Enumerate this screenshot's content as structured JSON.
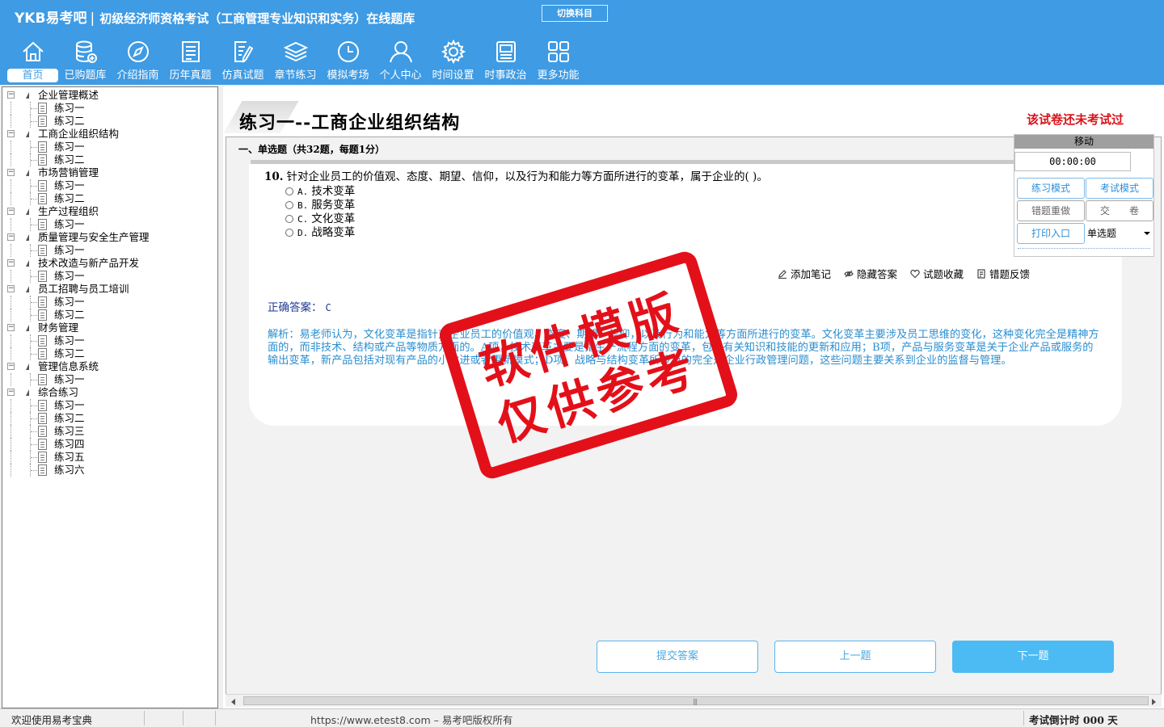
{
  "header": {
    "brand": "YKB易考吧",
    "separator": "|",
    "exam_title": "初级经济师资格考试（工商管理专业知识和实务）在线题库",
    "switch_subject": "切换科目",
    "nav": [
      {
        "label": "首页",
        "icon": "home-icon"
      },
      {
        "label": "已购题库",
        "icon": "database-icon"
      },
      {
        "label": "介绍指南",
        "icon": "compass-icon"
      },
      {
        "label": "历年真题",
        "icon": "list-icon"
      },
      {
        "label": "仿真试题",
        "icon": "edit-document-icon"
      },
      {
        "label": "章节练习",
        "icon": "layers-icon"
      },
      {
        "label": "模拟考场",
        "icon": "clock-icon"
      },
      {
        "label": "个人中心",
        "icon": "user-icon"
      },
      {
        "label": "时间设置",
        "icon": "gear-icon"
      },
      {
        "label": "时事政治",
        "icon": "newspaper-icon"
      },
      {
        "label": "更多功能",
        "icon": "grid-icon"
      }
    ]
  },
  "tree": [
    {
      "label": "企业管理概述",
      "children": [
        "练习一",
        "练习二"
      ]
    },
    {
      "label": "工商企业组织结构",
      "children": [
        "练习一",
        "练习二"
      ]
    },
    {
      "label": "市场营销管理",
      "children": [
        "练习一",
        "练习二"
      ]
    },
    {
      "label": "生产过程组织",
      "children": [
        "练习一"
      ]
    },
    {
      "label": "质量管理与安全生产管理",
      "children": [
        "练习一"
      ]
    },
    {
      "label": "技术改造与新产品开发",
      "children": [
        "练习一"
      ]
    },
    {
      "label": "员工招聘与员工培训",
      "children": [
        "练习一",
        "练习二"
      ]
    },
    {
      "label": "财务管理",
      "children": [
        "练习一",
        "练习二"
      ]
    },
    {
      "label": "管理信息系统",
      "children": [
        "练习一"
      ]
    },
    {
      "label": "综合练习",
      "children": [
        "练习一",
        "练习二",
        "练习三",
        "练习四",
        "练习五",
        "练习六"
      ]
    }
  ],
  "main": {
    "page_title": "练习一--工商企业组织结构",
    "not_taken": "该试卷还未考试过",
    "section_title": "一、单选题（共32题，每题1分）",
    "question": {
      "number": "10.",
      "text": "针对企业员工的价值观、态度、期望、信仰，以及行为和能力等方面所进行的变革，属于企业的( )。",
      "options": [
        {
          "letter": "A.",
          "text": "技术变革"
        },
        {
          "letter": "B.",
          "text": "服务变革"
        },
        {
          "letter": "C.",
          "text": "文化变革"
        },
        {
          "letter": "D.",
          "text": "战略变革"
        }
      ]
    },
    "tools": {
      "add_note": "添加笔记",
      "hide_answer": "隐藏答案",
      "favorite": "试题收藏",
      "feedback": "错题反馈"
    },
    "answer_label": "正确答案：",
    "answer_value": "C",
    "analysis": "解析：易老师认为，文化变革是指针对企业员工的价值观、态度、期望、信仰，以及行为和能力等方面所进行的变革。文化变革主要涉及员工思维的变化，这种变化完全是精神方面的，而非技术、结构或产品等物质方面的。A项，技术变革主要是指生产流程方面的变革，包括有关知识和技能的更新和应用；B项，产品与服务变革是关于企业产品或服务的输出变革，新产品包括对现有产品的小改进或者更新模式；D项，战略与结构变革所涉及的完全是企业行政管理问题，这些问题主要关系到企业的监督与管理。",
    "buttons": {
      "submit": "提交答案",
      "prev": "上一题",
      "next": "下一题"
    }
  },
  "control": {
    "move": "移动",
    "timer": "00:00:00",
    "practice_mode": "练习模式",
    "exam_mode": "考试模式",
    "redo_wrong": "错题重做",
    "hand_in": "交　　卷",
    "print": "打印入口",
    "question_type": "单选题"
  },
  "watermark": {
    "line1": "软件模版",
    "line2": "仅供参考"
  },
  "status": {
    "welcome": "欢迎使用易考宝典",
    "url": "https://www.etest8.com – 易考吧版权所有",
    "countdown": "考试倒计时 000 天"
  },
  "colors": {
    "header_bg": "#3e9be4",
    "accent_red": "#d8141b",
    "analysis_blue": "#2b8ecf",
    "answer_blue": "#1f3a93",
    "next_button": "#4cbbf4"
  }
}
